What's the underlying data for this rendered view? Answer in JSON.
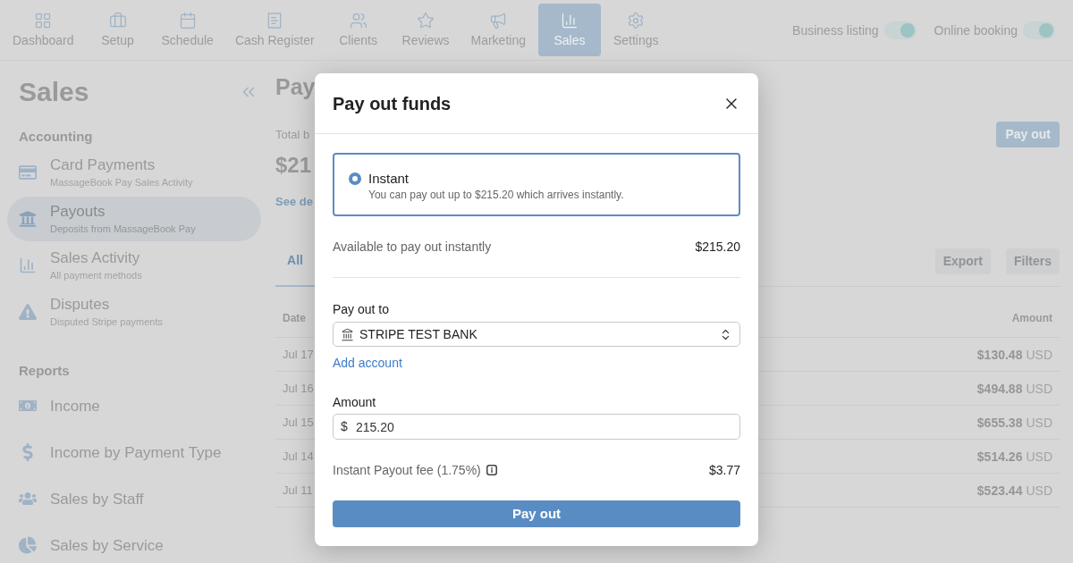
{
  "nav": {
    "items": [
      {
        "label": "Dashboard",
        "selected": false
      },
      {
        "label": "Setup",
        "selected": false
      },
      {
        "label": "Schedule",
        "selected": false
      },
      {
        "label": "Cash Register",
        "selected": false
      },
      {
        "label": "Clients",
        "selected": false
      },
      {
        "label": "Reviews",
        "selected": false
      },
      {
        "label": "Marketing",
        "selected": false
      },
      {
        "label": "Sales",
        "selected": true
      },
      {
        "label": "Settings",
        "selected": false
      }
    ],
    "toggles": [
      {
        "label": "Business listing",
        "on": true
      },
      {
        "label": "Online booking",
        "on": true
      }
    ]
  },
  "sidebar": {
    "title": "Sales",
    "sections": [
      {
        "heading": "Accounting",
        "items": [
          {
            "title": "Card Payments",
            "subtitle": "MassageBook Pay Sales Activity",
            "selected": false
          },
          {
            "title": "Payouts",
            "subtitle": "Deposits from MassageBook Pay",
            "selected": true
          },
          {
            "title": "Sales Activity",
            "subtitle": "All payment methods",
            "selected": false
          },
          {
            "title": "Disputes",
            "subtitle": "Disputed Stripe payments",
            "selected": false
          }
        ]
      },
      {
        "heading": "Reports",
        "items": [
          {
            "title": "Income",
            "selected": false
          },
          {
            "title": "Income by Payment Type",
            "selected": false
          },
          {
            "title": "Sales by Staff",
            "selected": false
          },
          {
            "title": "Sales by Service",
            "selected": false
          }
        ]
      }
    ]
  },
  "main": {
    "title": "Pay",
    "balance_label": "Total b",
    "balance": "$21",
    "details_link": "See de",
    "pay_out_button": "Pay out",
    "tabs": [
      {
        "label": "All",
        "selected": true
      }
    ],
    "actions": [
      "Export",
      "Filters"
    ],
    "table": {
      "columns": [
        "Date",
        "Amount"
      ],
      "rows": [
        {
          "date": "Jul 17",
          "amount": "$130.48",
          "currency": "USD"
        },
        {
          "date": "Jul 16",
          "amount": "$494.88",
          "currency": "USD"
        },
        {
          "date": "Jul 15",
          "amount": "$655.38",
          "currency": "USD"
        },
        {
          "date": "Jul 14",
          "amount": "$514.26",
          "currency": "USD"
        },
        {
          "date": "Jul 11",
          "amount": "$523.44",
          "currency": "USD"
        }
      ]
    }
  },
  "modal": {
    "title": "Pay out funds",
    "options": [
      {
        "label": "Instant",
        "description": "You can pay out up to $215.20 which arrives instantly.",
        "selected": true
      }
    ],
    "available": {
      "label": "Available to pay out instantly",
      "value": "$215.20"
    },
    "destination": {
      "label": "Pay out to",
      "value": "STRIPE TEST BANK",
      "link": "Add account"
    },
    "amount": {
      "label": "Amount",
      "prefix": "$",
      "value": "215.20"
    },
    "fee": {
      "label": "Instant Payout fee (1.75%)",
      "value": "$3.77"
    },
    "submit": "Pay out"
  }
}
